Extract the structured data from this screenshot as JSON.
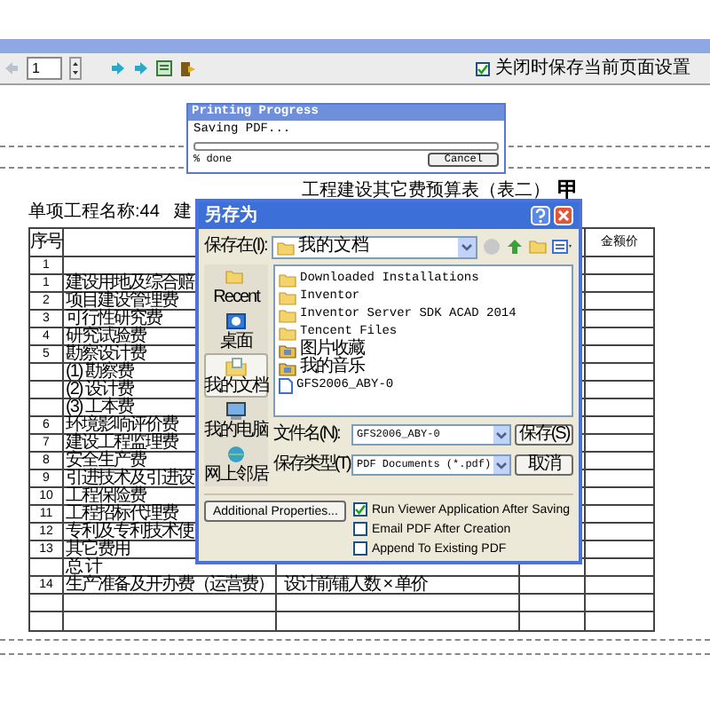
{
  "toolbar": {
    "page_field": "1",
    "keep_settings": {
      "label": "关闭时保存当前页面设置",
      "checked": true
    }
  },
  "document": {
    "title": "工程建设其它费预算表（表二）",
    "title_suffix": "甲",
    "project_label": "单项工程名称:44",
    "header_fragment": "建",
    "table": {
      "header_number": "序号",
      "header_amount": "金额价",
      "rows": [
        {
          "number": "1"
        },
        {
          "number": "1",
          "name": "建设用地及综合赔"
        },
        {
          "number": "2",
          "name": "项目建设管理费"
        },
        {
          "number": "3",
          "name": "可行性研究费"
        },
        {
          "number": "4",
          "name": "研究试验费"
        },
        {
          "number": "5",
          "name": "勘察设计费"
        },
        {
          "name": "(1) 勘察费"
        },
        {
          "name": "(2) 设计费"
        },
        {
          "name": "(3) 工本费"
        },
        {
          "number": "6",
          "name": "环境影响评价费"
        },
        {
          "number": "7",
          "name": "建设工程监理费"
        },
        {
          "number": "8",
          "name": "安全生产费"
        },
        {
          "number": "9",
          "name": "引进技术及引进设"
        },
        {
          "number": "10",
          "name": "工程保险费"
        },
        {
          "number": "11",
          "name": "工程招标代理费"
        },
        {
          "number": "12",
          "name": "专利及专利技术使"
        },
        {
          "number": "13",
          "name": "其它费用"
        },
        {
          "name": "总  计"
        },
        {
          "number": "14",
          "name": "生产准备及开办费（运营费）",
          "basis": "设计前铺人数 × 单价"
        },
        {},
        {}
      ]
    }
  },
  "progress_dialog": {
    "title": "Printing Progress",
    "status": "Saving PDF...",
    "level": 0,
    "progress_text": "% done",
    "cancel": "Cancel"
  },
  "save_dialog": {
    "title": "另存为",
    "save_in_label": "保存在(I):",
    "save_in_value": "我的文档",
    "places": [
      {
        "label": "Recent",
        "kind": "recent",
        "selected": false
      },
      {
        "label": "桌面",
        "kind": "desktop",
        "selected": false
      },
      {
        "label": "我的文档",
        "kind": "documents",
        "selected": true
      },
      {
        "label": "我的电脑",
        "kind": "computer",
        "selected": false
      },
      {
        "label": "网上邻居",
        "kind": "network",
        "selected": false
      }
    ],
    "files": [
      {
        "name": "Downloaded Installations",
        "kind": "folder"
      },
      {
        "name": "Inventor",
        "kind": "folder"
      },
      {
        "name": "Inventor Server SDK ACAD 2014",
        "kind": "folder"
      },
      {
        "name": "Tencent Files",
        "kind": "folder"
      },
      {
        "name": "图片收藏",
        "kind": "special"
      },
      {
        "name": "我的音乐",
        "kind": "special"
      },
      {
        "name": "GFS2006_ABY-0",
        "kind": "file"
      }
    ],
    "filename_label": "文件名(N):",
    "filename": "GFS2006_ABY-0",
    "filetype_label": "保存类型(T):",
    "filetype": "PDF Documents (*.pdf)",
    "save_button": "保存(S)",
    "cancel_button": "取消",
    "additional_button": "Additional Properties...",
    "options": [
      {
        "label": "Run Viewer Application After Saving",
        "checked": true
      },
      {
        "label": "Email PDF After Creation",
        "checked": false
      },
      {
        "label": "Append To Existing PDF",
        "checked": false
      }
    ]
  }
}
